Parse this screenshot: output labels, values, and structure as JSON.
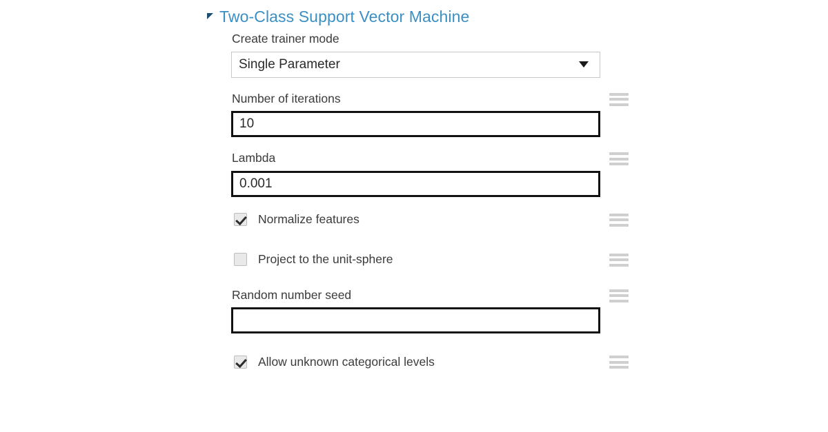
{
  "module": {
    "title": "Two-Class Support Vector Machine",
    "collapse_icon": "collapse-triangle-icon",
    "title_color": "#3b8fc4"
  },
  "fields": {
    "trainer_mode": {
      "label": "Create trainer mode",
      "value": "Single Parameter",
      "arrow_icon": "chevron-down-icon",
      "options": [
        "Single Parameter"
      ]
    },
    "iterations": {
      "label": "Number of iterations",
      "value": "10",
      "placeholder": ""
    },
    "lambda": {
      "label": "Lambda",
      "value": "0.001",
      "placeholder": ""
    },
    "normalize_features": {
      "label": "Normalize features",
      "checked": true
    },
    "project_unit_sphere": {
      "label": "Project to the unit-sphere",
      "checked": false
    },
    "random_seed": {
      "label": "Random number seed",
      "value": "",
      "placeholder": ""
    },
    "allow_unknown_levels": {
      "label": "Allow unknown categorical levels",
      "checked": true
    }
  },
  "handle_icon": "drag-handle-icon",
  "colors": {
    "accent": "#3b8fc4",
    "label": "#3b3b3b",
    "input_border": "#111111",
    "select_border": "#c8c8c8",
    "handle": "#cfcfcf",
    "background": "#ffffff"
  }
}
